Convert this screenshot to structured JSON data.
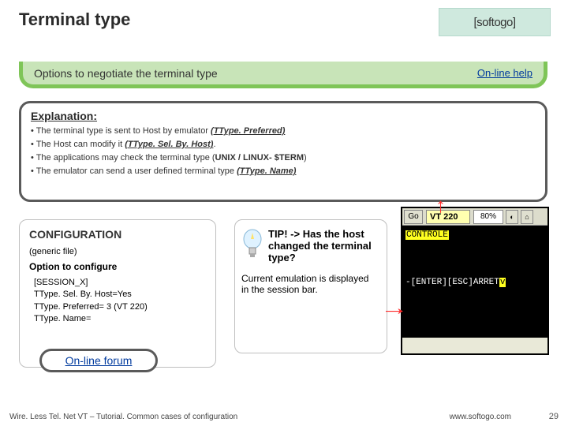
{
  "header": {
    "title": "Terminal type",
    "logo": "[softogo]"
  },
  "banner": {
    "title": "Options to negotiate the terminal type",
    "help": "On-line help"
  },
  "explanation": {
    "heading": "Explanation:",
    "b1_pre": "• The terminal type is sent to Host by emulator ",
    "b1_u": "(TType. Preferred)",
    "b2_pre": "• The Host can modify it ",
    "b2_u": "(TType. Sel. By. Host)",
    "b2_post": ".",
    "b3_pre": "• The applications may check the terminal type (",
    "b3_b": "UNIX  / LINUX- $TERM",
    "b3_post": ")",
    "b4_pre": "• The emulator can send a user defined terminal type ",
    "b4_u": "(TType. Name)"
  },
  "config": {
    "heading": "CONFIGURATION",
    "sub": "(generic file)",
    "opt": "Option to configure",
    "l1": "[SESSION_X]",
    "l2": " TType. Sel. By. Host=Yes",
    "l3": " TType. Preferred= 3 (VT 220)",
    "l4": " TType. Name="
  },
  "forum": {
    "link": "On-line forum"
  },
  "tip": {
    "tip1": "TIP!  -> Has the host changed the terminal type?",
    "sub": "Current emulation is displayed in the session bar."
  },
  "emu": {
    "btn1": "Go",
    "field": "VT 220",
    "pct": "80%",
    "sp1": "◐",
    "sp2": "⌂",
    "line1": "CONTROLE",
    "line2": "-[ENTER][ESC]ARRET"
  },
  "footer": {
    "left": "Wire. Less Tel. Net VT – Tutorial. Common cases of configuration",
    "right": "www.softogo.com",
    "page": "29"
  }
}
